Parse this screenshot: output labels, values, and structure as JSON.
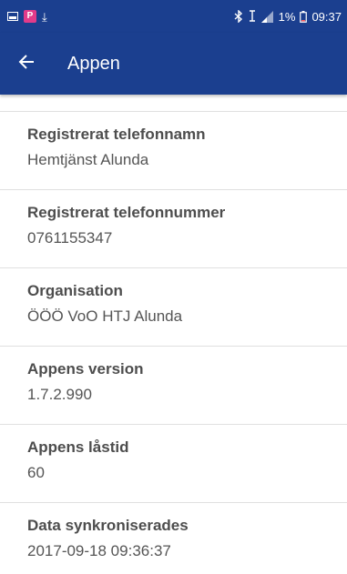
{
  "status_bar": {
    "battery_percent": "1%",
    "time": "09:37"
  },
  "app_bar": {
    "title": "Appen",
    "back_icon": "arrow-left-icon"
  },
  "colors": {
    "primary": "#1b3f8f",
    "label": "#4d4d4d",
    "value": "#555555",
    "divider": "#e0e0e0"
  },
  "items": [
    {
      "label": "Registrerat telefonnamn",
      "value": "Hemtjänst Alunda"
    },
    {
      "label": "Registrerat telefonnummer",
      "value": "0761155347"
    },
    {
      "label": "Organisation",
      "value": "ÖÖÖ VoO HTJ Alunda"
    },
    {
      "label": "Appens version",
      "value": "1.7.2.990"
    },
    {
      "label": "Appens låstid",
      "value": "60"
    },
    {
      "label": "Data synkroniserades",
      "value": "2017-09-18 09:36:37"
    }
  ]
}
